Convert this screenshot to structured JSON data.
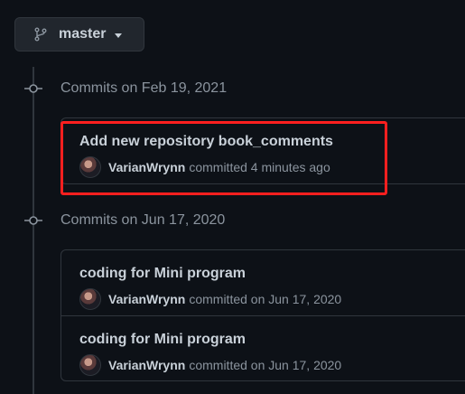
{
  "branch": {
    "label": "master"
  },
  "groups": [
    {
      "title": "Commits on Feb 19, 2021",
      "commits": [
        {
          "title": "Add new repository book_comments",
          "author": "VarianWrynn",
          "time": "committed 4 minutes ago"
        }
      ]
    },
    {
      "title": "Commits on Jun 17, 2020",
      "commits": [
        {
          "title": "coding for Mini program",
          "author": "VarianWrynn",
          "time": "committed on Jun 17, 2020"
        },
        {
          "title": "coding for Mini program",
          "author": "VarianWrynn",
          "time": "committed on Jun 17, 2020"
        }
      ]
    }
  ],
  "colors": {
    "background": "#0d1117",
    "border": "#30363d",
    "highlight": "#ff1f1f"
  },
  "icons": {
    "branch": "git-branch-icon",
    "commit": "git-commit-icon",
    "caret": "triangle-down-icon"
  }
}
